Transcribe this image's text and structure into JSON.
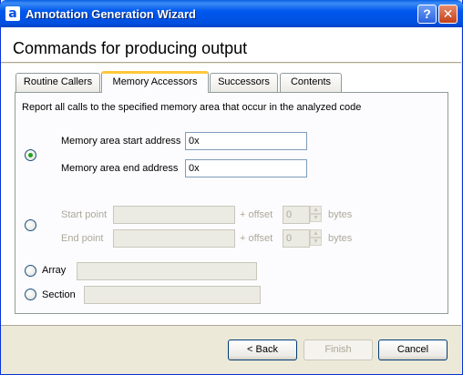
{
  "window": {
    "title": "Annotation Generation Wizard",
    "app_icon": "a",
    "help_label": "?",
    "close_label": "✕"
  },
  "header": {
    "title": "Commands for producing output"
  },
  "tabs": [
    {
      "label": "Routine Callers",
      "active": false
    },
    {
      "label": "Memory Accessors",
      "active": true
    },
    {
      "label": "Successors",
      "active": false
    },
    {
      "label": "Contents",
      "active": false
    }
  ],
  "panel": {
    "description": "Report all calls to the specified memory area that occur in the analyzed code",
    "address_option": {
      "selected": true,
      "start_label": "Memory area start address",
      "start_value": "0x",
      "end_label": "Memory area end address",
      "end_value": "0x"
    },
    "point_option": {
      "selected": false,
      "start_label": "Start point",
      "end_label": "End point",
      "offset_label": "+ offset",
      "start_offset": "0",
      "end_offset": "0",
      "unit": "bytes"
    },
    "array_option": {
      "selected": false,
      "label": "Array"
    },
    "section_option": {
      "selected": false,
      "label": "Section"
    }
  },
  "footer": {
    "back_label": "< Back",
    "finish_label": "Finish",
    "cancel_label": "Cancel"
  }
}
